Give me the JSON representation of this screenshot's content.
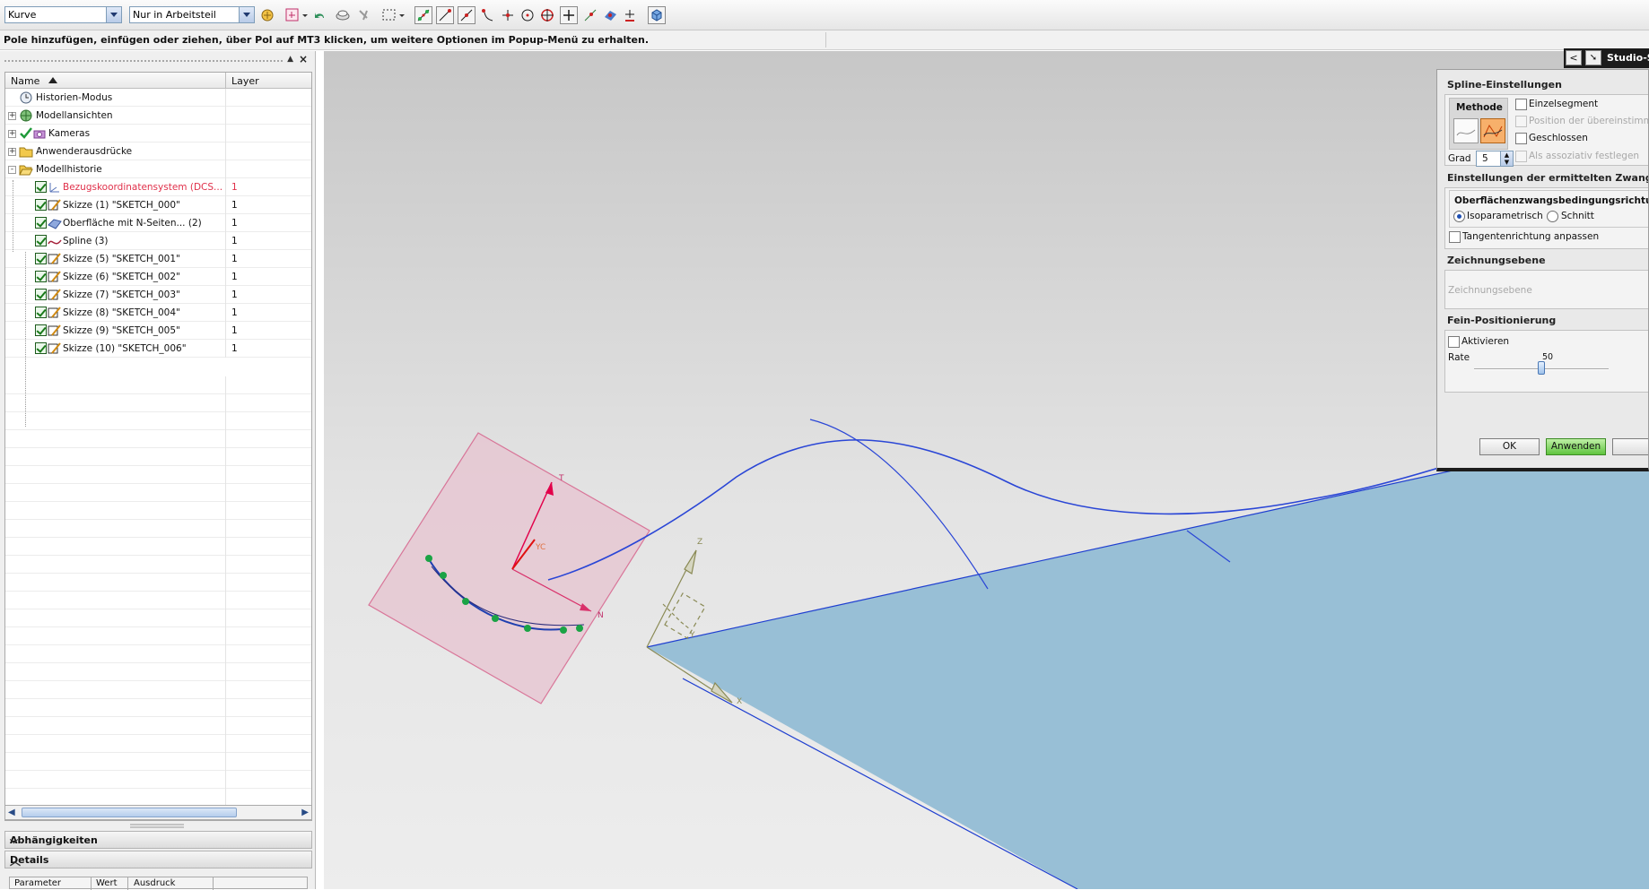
{
  "toolbar": {
    "filter_combo": "Kurve",
    "scope_combo": "Nur in Arbeitsteil"
  },
  "status_message": "Pole hinzufügen, einfügen oder ziehen, über Pol auf MT3 klicken, um weitere Optionen im Popup-Menü zu erhalten.",
  "navigator": {
    "columns": {
      "name": "Name",
      "layer": "Layer"
    },
    "nodes": [
      {
        "label": "Historien-Modus",
        "icon": "clock-icon",
        "indent": 1
      },
      {
        "label": "Modellansichten",
        "icon": "views-icon",
        "indent": 0,
        "expander": "+"
      },
      {
        "label": "Kameras",
        "icon": "camera-icon",
        "indent": 0,
        "expander": "+"
      },
      {
        "label": "Anwenderausdrücke",
        "icon": "folder-icon",
        "indent": 0,
        "expander": "+"
      },
      {
        "label": "Modellhistorie",
        "icon": "open-folder-icon",
        "indent": 0,
        "expander": "-"
      }
    ],
    "features": [
      {
        "label": "Bezugskoordinatensystem (DCS...",
        "layer": "1",
        "icon": "datum-csys-icon",
        "error": true
      },
      {
        "label": "Skizze (1) \"SKETCH_000\"",
        "layer": "1",
        "icon": "sketch-icon"
      },
      {
        "label": "Oberfläche mit N-Seiten... (2)",
        "layer": "1",
        "icon": "surface-icon"
      },
      {
        "label": "Spline (3)",
        "layer": "1",
        "icon": "spline-icon"
      },
      {
        "label": "Skizze (5) \"SKETCH_001\"",
        "layer": "1",
        "icon": "sketch-icon"
      },
      {
        "label": "Skizze (6) \"SKETCH_002\"",
        "layer": "1",
        "icon": "sketch-icon"
      },
      {
        "label": "Skizze (7) \"SKETCH_003\"",
        "layer": "1",
        "icon": "sketch-icon"
      },
      {
        "label": "Skizze (8) \"SKETCH_004\"",
        "layer": "1",
        "icon": "sketch-icon"
      },
      {
        "label": "Skizze (9) \"SKETCH_005\"",
        "layer": "1",
        "icon": "sketch-icon"
      },
      {
        "label": "Skizze (10) \"SKETCH_006\"",
        "layer": "1",
        "icon": "sketch-icon"
      }
    ],
    "panels": {
      "dependencies": "Abhängigkeiten",
      "details": "Details",
      "details_columns": [
        "Parameter",
        "Wert",
        "Ausdruck"
      ]
    }
  },
  "viewport": {
    "axis_labels": {
      "t": "T",
      "yc": "YC",
      "n": "N",
      "z": "Z",
      "y": "Y",
      "x": "X"
    },
    "colors": {
      "sheet": "#98bfd6",
      "plane": "#e7c6d2",
      "curve": "#2a46d6",
      "poles": "#1aa345"
    }
  },
  "dialog": {
    "tab_title": "Studio-S",
    "spline_section": "Spline-Einstellungen",
    "method_label": "Methode",
    "single_segment": "Einzelsegment",
    "match_position": "Position der übereinstimm",
    "closed": "Geschlossen",
    "degree_label": "Grad",
    "degree_value": "5",
    "associative": "Als assoziativ festlegen",
    "constraints_section": "Einstellungen der ermittelten Zwangsbe",
    "surface_constraint_title": "Oberflächenzwangsbedingungsrichtun",
    "isoparametric": "Isoparametrisch",
    "section_option": "Schnitt",
    "match_tangent": "Tangentenrichtung anpassen",
    "drawing_plane_section": "Zeichnungsebene",
    "drawing_plane_placeholder": "Zeichnungsebene",
    "fine_positioning_section": "Fein-Positionierung",
    "activate": "Aktivieren",
    "rate_label": "Rate",
    "rate_value": "50",
    "ok": "OK",
    "apply": "Anwenden"
  }
}
